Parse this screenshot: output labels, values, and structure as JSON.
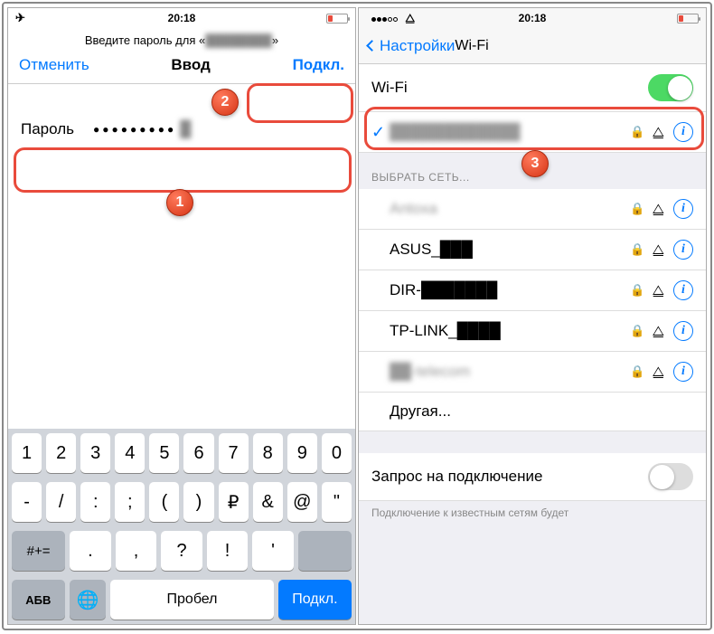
{
  "left": {
    "status": {
      "time": "20:18"
    },
    "prompt_prefix": "Введите пароль для «",
    "prompt_net": "████████",
    "prompt_suffix": "»",
    "cancel": "Отменить",
    "title": "Ввод",
    "connect": "Подкл.",
    "pw_label": "Пароль",
    "pw_dots": "●●●●●●●●●",
    "kb": {
      "r1": [
        "1",
        "2",
        "3",
        "4",
        "5",
        "6",
        "7",
        "8",
        "9",
        "0"
      ],
      "r2": [
        "-",
        "/",
        ":",
        ";",
        "(",
        ")",
        "₽",
        "&",
        "@",
        "\""
      ],
      "sym": "#+=",
      "r3": [
        ".",
        ",",
        "?",
        "!",
        "'"
      ],
      "abc": "АБВ",
      "space": "Пробел",
      "go": "Подкл."
    }
  },
  "right": {
    "status": {
      "time": "20:18"
    },
    "back": "Настройки",
    "title": "Wi-Fi",
    "wifi_toggle_label": "Wi-Fi",
    "connected": "████████████",
    "section": "ВЫБРАТЬ СЕТЬ...",
    "nets": [
      "Antoxa",
      "ASUS_███",
      "DIR-███████",
      "TP-LINK_████",
      "██-telecom"
    ],
    "other": "Другая...",
    "ask": "Запрос на подключение",
    "foot": "Подключение к известным сетям будет"
  },
  "badges": {
    "b1": "1",
    "b2": "2",
    "b3": "3"
  }
}
